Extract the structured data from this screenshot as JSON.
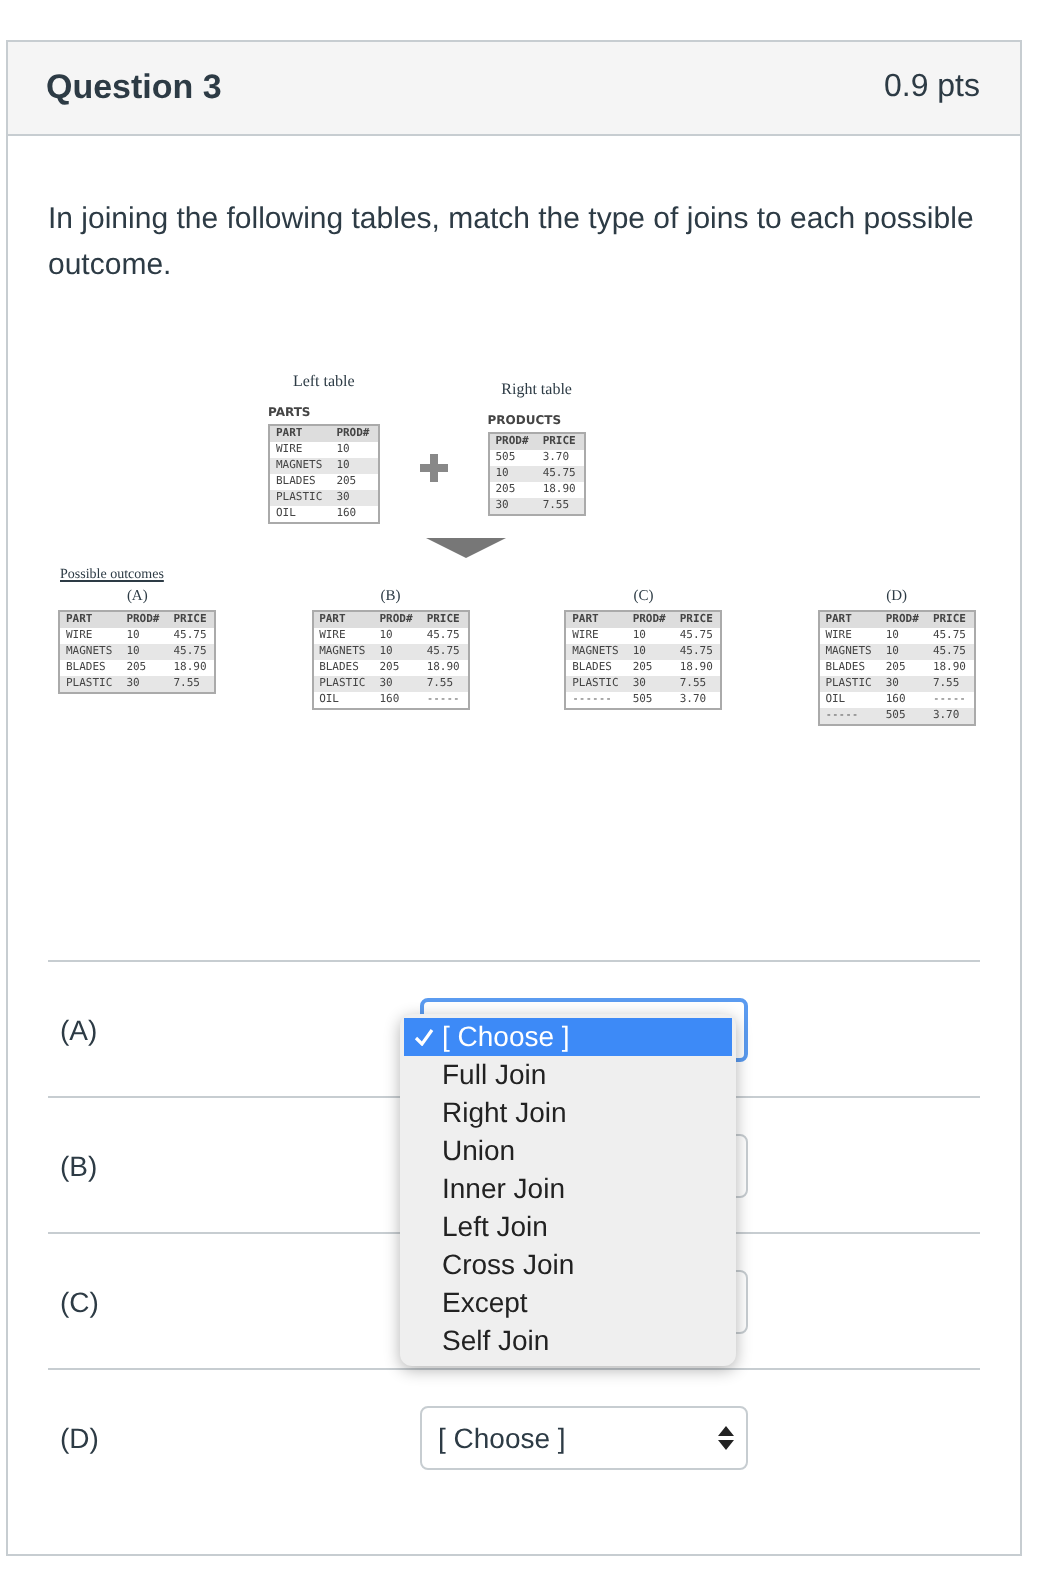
{
  "question": {
    "title": "Question 3",
    "points": "0.9 pts"
  },
  "prompt": "In joining the following tables, match the type of joins to each possible outcome.",
  "figure": {
    "left_table": {
      "caption": "Left table",
      "name": "PARTS",
      "columns": [
        "PART",
        "PROD#"
      ],
      "rows": [
        [
          "WIRE",
          "10"
        ],
        [
          "MAGNETS",
          "10"
        ],
        [
          "BLADES",
          "205"
        ],
        [
          "PLASTIC",
          "30"
        ],
        [
          "OIL",
          "160"
        ]
      ]
    },
    "right_table": {
      "caption": "Right table",
      "name": "PRODUCTS",
      "columns": [
        "PROD#",
        "PRICE"
      ],
      "rows": [
        [
          "505",
          "3.70"
        ],
        [
          "10",
          "45.75"
        ],
        [
          "205",
          "18.90"
        ],
        [
          "30",
          "7.55"
        ]
      ]
    },
    "outcomes_heading": "Possible outcomes",
    "outcomes": [
      {
        "label": "(A)",
        "columns": [
          "PART",
          "PROD#",
          "PRICE"
        ],
        "rows": [
          [
            "WIRE",
            "10",
            "45.75"
          ],
          [
            "MAGNETS",
            "10",
            "45.75"
          ],
          [
            "BLADES",
            "205",
            "18.90"
          ],
          [
            "PLASTIC",
            "30",
            "7.55"
          ]
        ]
      },
      {
        "label": "(B)",
        "columns": [
          "PART",
          "PROD#",
          "PRICE"
        ],
        "rows": [
          [
            "WIRE",
            "10",
            "45.75"
          ],
          [
            "MAGNETS",
            "10",
            "45.75"
          ],
          [
            "BLADES",
            "205",
            "18.90"
          ],
          [
            "PLASTIC",
            "30",
            "7.55"
          ],
          [
            "OIL",
            "160",
            "-----"
          ]
        ]
      },
      {
        "label": "(C)",
        "columns": [
          "PART",
          "PROD#",
          "PRICE"
        ],
        "rows": [
          [
            "WIRE",
            "10",
            "45.75"
          ],
          [
            "MAGNETS",
            "10",
            "45.75"
          ],
          [
            "BLADES",
            "205",
            "18.90"
          ],
          [
            "PLASTIC",
            "30",
            "7.55"
          ],
          [
            "------",
            "505",
            "3.70"
          ]
        ]
      },
      {
        "label": "(D)",
        "columns": [
          "PART",
          "PROD#",
          "PRICE"
        ],
        "rows": [
          [
            "WIRE",
            "10",
            "45.75"
          ],
          [
            "MAGNETS",
            "10",
            "45.75"
          ],
          [
            "BLADES",
            "205",
            "18.90"
          ],
          [
            "PLASTIC",
            "30",
            "7.55"
          ],
          [
            "OIL",
            "160",
            "-----"
          ],
          [
            "-----",
            "505",
            "3.70"
          ]
        ]
      }
    ]
  },
  "answers": [
    {
      "label": "(A)",
      "focused": true
    },
    {
      "label": "(B)",
      "focused": false
    },
    {
      "label": "(C)",
      "focused": false
    },
    {
      "label": "(D)",
      "focused": false,
      "value": "[ Choose ]"
    }
  ],
  "dropdown_menu": {
    "options": [
      {
        "label": "[ Choose ]",
        "selected": true
      },
      {
        "label": "Full Join",
        "selected": false
      },
      {
        "label": "Right Join",
        "selected": false
      },
      {
        "label": "Union",
        "selected": false
      },
      {
        "label": "Inner Join",
        "selected": false
      },
      {
        "label": "Left Join",
        "selected": false
      },
      {
        "label": "Cross Join",
        "selected": false
      },
      {
        "label": "Except",
        "selected": false
      },
      {
        "label": "Self Join",
        "selected": false
      }
    ]
  }
}
